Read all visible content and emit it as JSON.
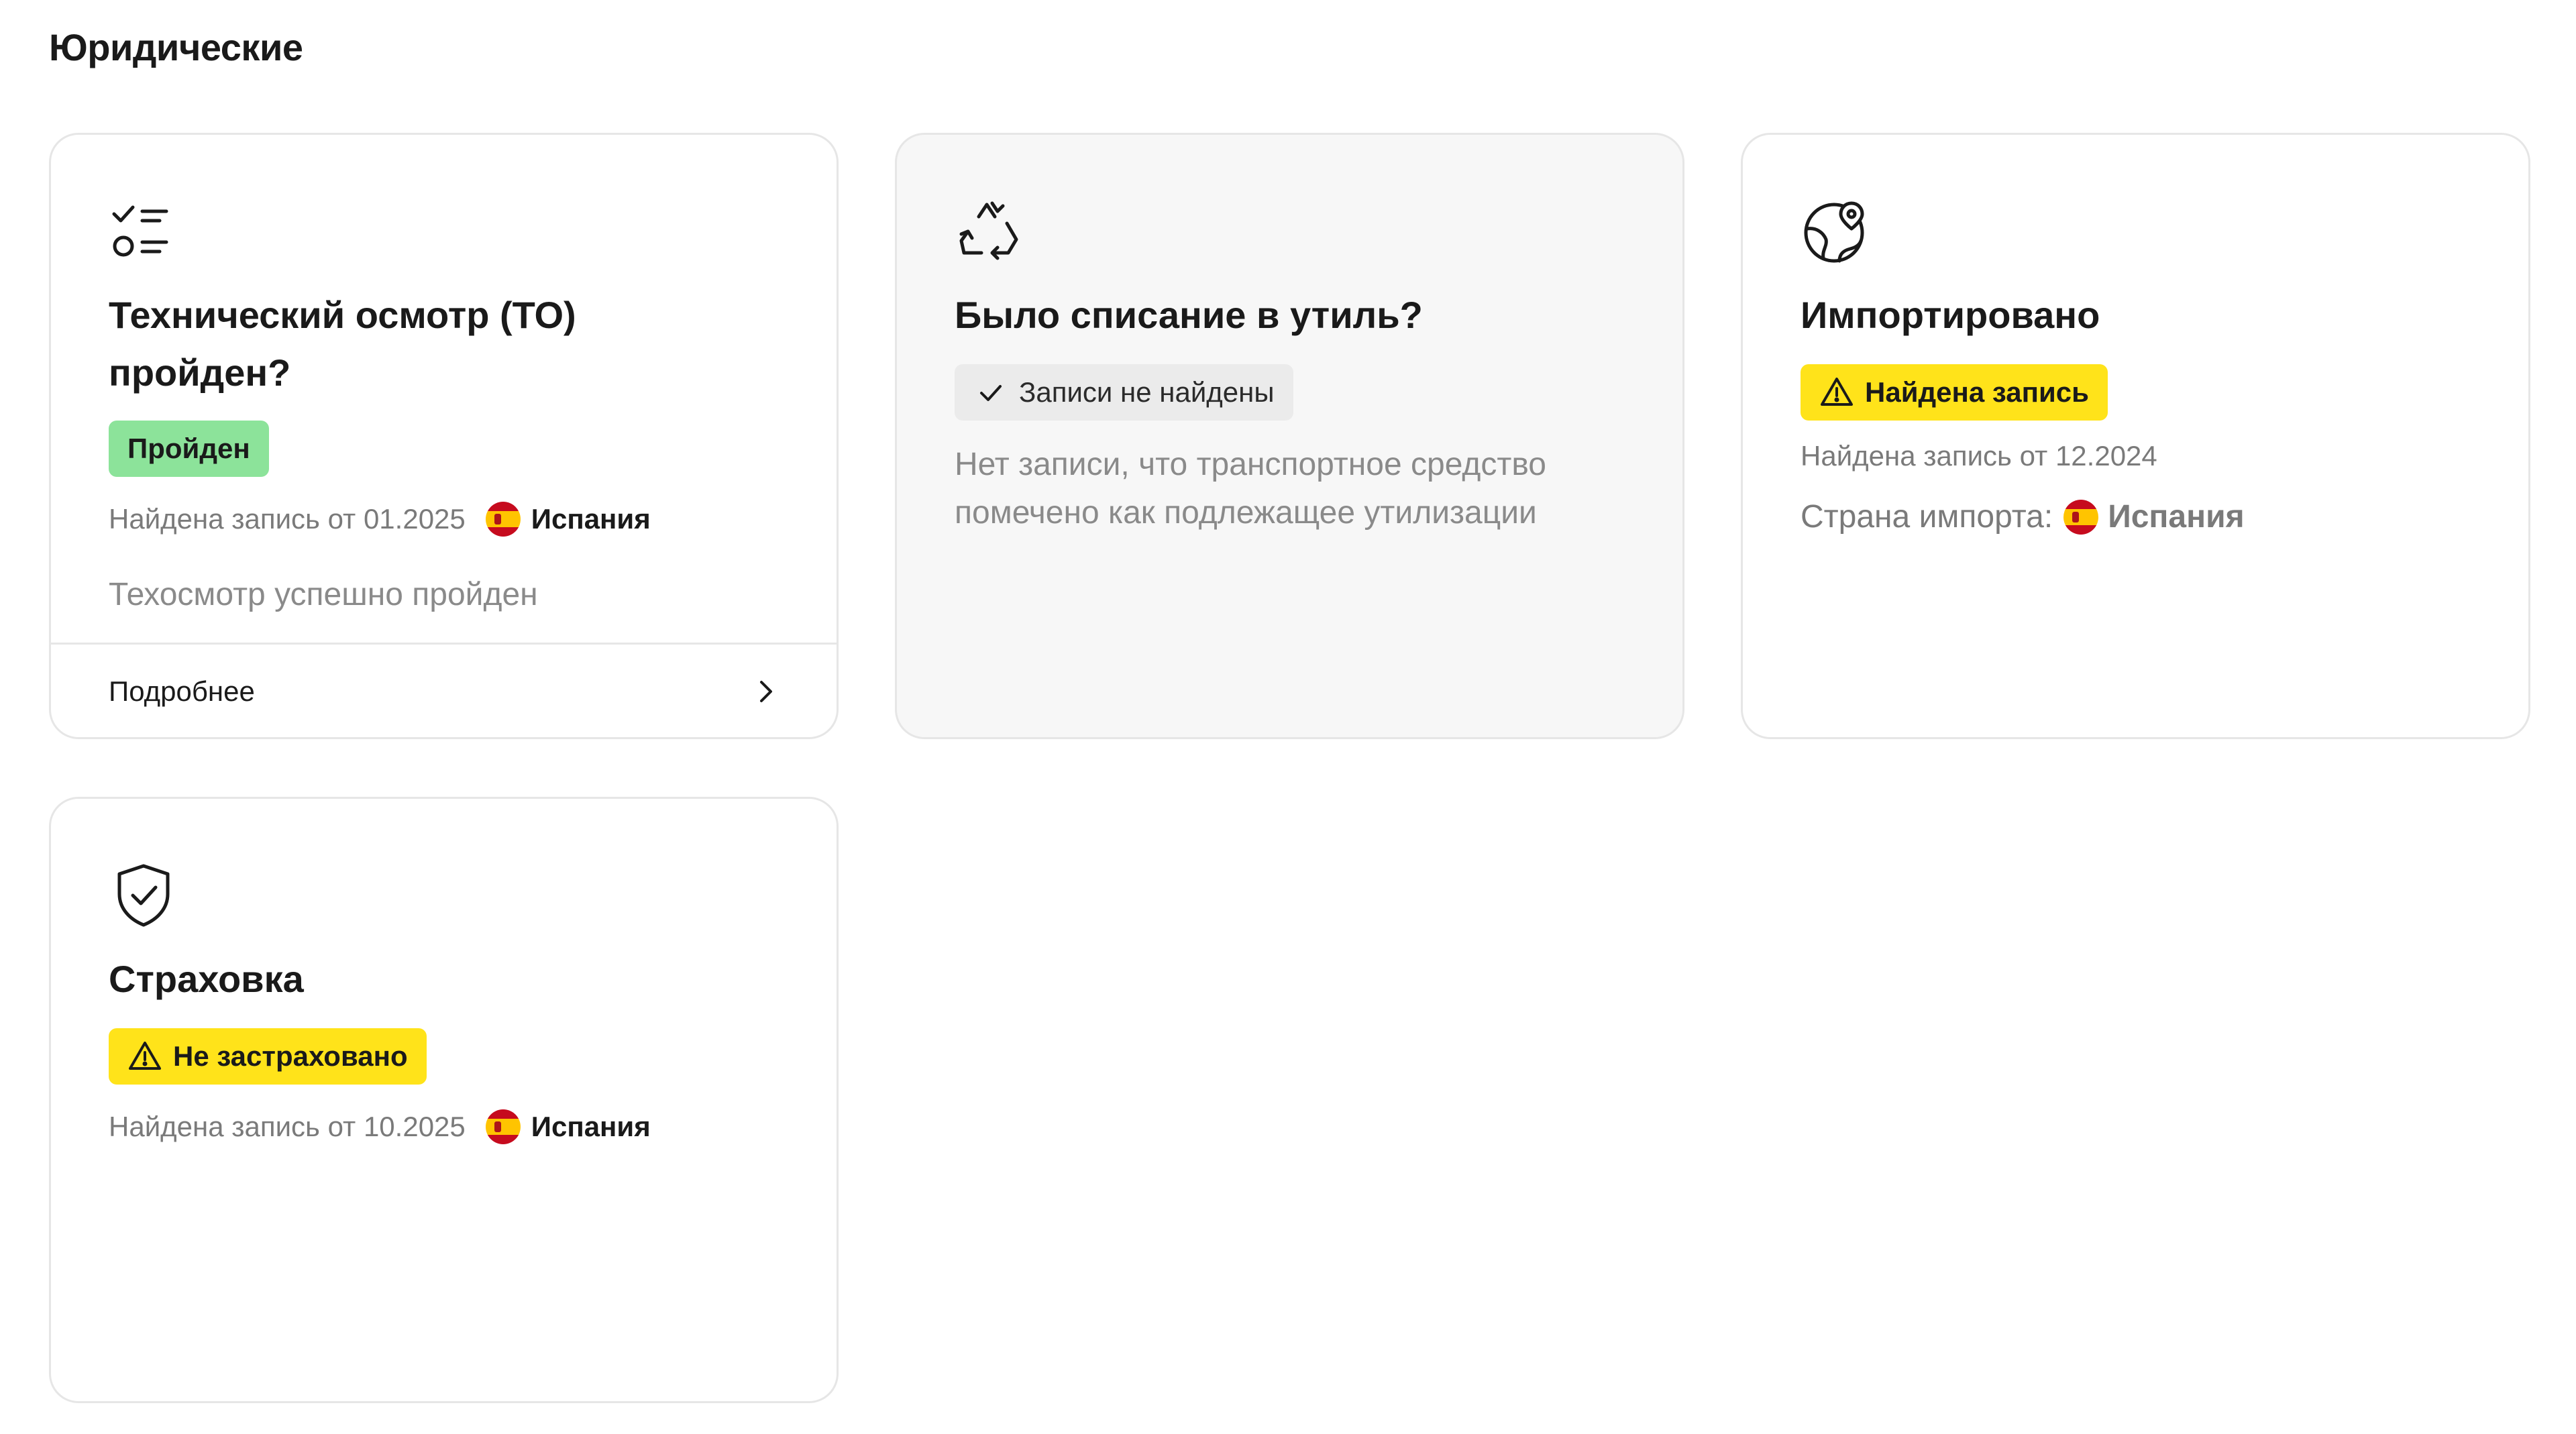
{
  "section": {
    "title": "Юридические"
  },
  "cards": {
    "inspection": {
      "icon": "checklist-icon",
      "title_line1": "Технический осмотр (ТО)",
      "title_line2": "пройден?",
      "badge": "Пройден",
      "record": "Найдена запись от 01.2025",
      "country": "Испания",
      "description": "Техосмотр успешно пройден",
      "more_label": "Подробнее"
    },
    "scrap": {
      "icon": "recycle-icon",
      "title": "Было списание в утиль?",
      "badge": "Записи не найдены",
      "description_line1": "Нет записи, что транспортное средство",
      "description_line2": "помечено как подлежащее утилизации"
    },
    "imported": {
      "icon": "globe-pin-icon",
      "title": "Импортировано",
      "badge": "Найдена запись",
      "record": "Найдена запись от 12.2024",
      "country_label": "Страна импорта:",
      "country": "Испания"
    },
    "insurance": {
      "icon": "shield-check-icon",
      "title": "Страховка",
      "badge": "Не застраховано",
      "record": "Найдена запись от 10.2025",
      "country": "Испания"
    }
  },
  "colors": {
    "badge_green": "#8ce39a",
    "badge_yellow": "#ffe31a",
    "card_border": "#e6e6e6",
    "muted_text": "#7a7a7a"
  }
}
